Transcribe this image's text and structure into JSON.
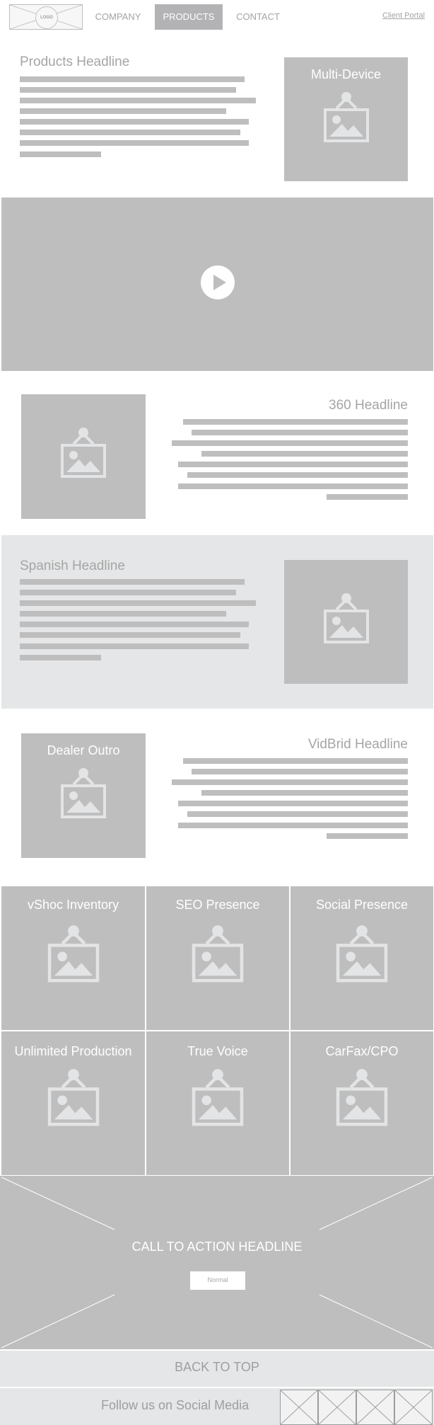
{
  "nav": {
    "logo": "LOGO",
    "links": [
      {
        "label": "COMPANY"
      },
      {
        "label": "PRODUCTS"
      },
      {
        "label": "CONTACT"
      }
    ],
    "portal": "Client Portal"
  },
  "products": {
    "headline": "Products Headline",
    "tile_title": "Multi-Device"
  },
  "video": {
    "play_icon": "play-icon"
  },
  "section_360": {
    "headline": "360 Headline"
  },
  "spanish": {
    "headline": "Spanish Headline"
  },
  "vidbrid": {
    "headline": "VidBrid Headline",
    "tile_title": "Dealer Outro"
  },
  "features": [
    {
      "label": "vShoc Inventory"
    },
    {
      "label": "SEO Presence"
    },
    {
      "label": "Social Presence"
    },
    {
      "label": "Unlimited Production"
    },
    {
      "label": "True Voice"
    },
    {
      "label": "CarFax/CPO"
    }
  ],
  "cta": {
    "headline": "CALL TO ACTION HEADLINE",
    "button": "Normal"
  },
  "back_to_top": "BACK TO TOP",
  "social": {
    "label": "Follow us on Social Media"
  },
  "colors": {
    "placeholder": "#bebebf",
    "band": "#e5e6e7",
    "nav_active": "#b3b3b5",
    "icon": "#e3e4e5"
  }
}
